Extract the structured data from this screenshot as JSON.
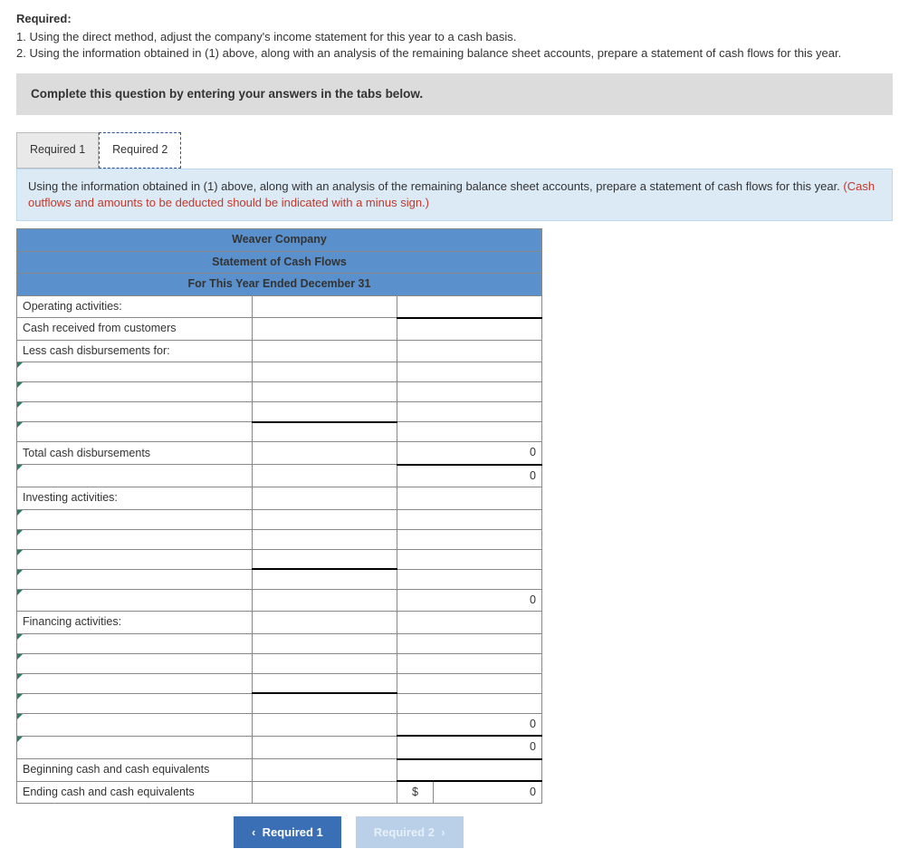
{
  "required": {
    "heading": "Required:",
    "item1": "1. Using the direct method, adjust the company's income statement for this year to a cash basis.",
    "item2": "2. Using the information obtained in (1) above, along with an analysis of the remaining balance sheet accounts, prepare a statement of cash flows for this year."
  },
  "gray_bar": "Complete this question by entering your answers in the tabs below.",
  "tabs": {
    "t1": "Required 1",
    "t2": "Required 2"
  },
  "instructions": {
    "main": "Using the information obtained in (1) above, along with an analysis of the remaining balance sheet accounts, prepare a statement of cash flows for this year. ",
    "red": "(Cash outflows and amounts to be deducted should be indicated with a minus sign.)"
  },
  "table": {
    "header": {
      "company": "Weaver Company",
      "title": "Statement of Cash Flows",
      "period": "For This Year Ended December 31"
    },
    "rows": {
      "operating": "Operating activities:",
      "cash_received": "Cash received from customers",
      "less_disb": "Less cash disbursements for:",
      "total_disb": "Total cash disbursements",
      "investing": "Investing activities:",
      "financing": "Financing activities:",
      "begin_cash": "Beginning cash and cash equivalents",
      "end_cash": "Ending cash and cash equivalents"
    },
    "values": {
      "zero": "0",
      "dollar": "$"
    }
  },
  "nav": {
    "prev": "Required 1",
    "next": "Required 2"
  }
}
